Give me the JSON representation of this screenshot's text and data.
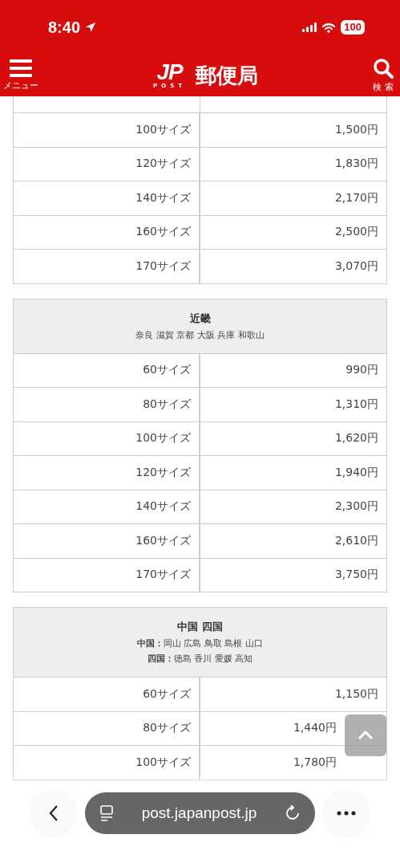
{
  "status_bar": {
    "time": "8:40",
    "battery": "100"
  },
  "header": {
    "menu_label": "メニュー",
    "logo_mark": "JP",
    "logo_sub": "POST",
    "title": "郵便局",
    "search_label": "検 索"
  },
  "sections": [
    {
      "rows": [
        {
          "size": "100サイズ",
          "price": "1,500円"
        },
        {
          "size": "120サイズ",
          "price": "1,830円"
        },
        {
          "size": "140サイズ",
          "price": "2,170円"
        },
        {
          "size": "160サイズ",
          "price": "2,500円"
        },
        {
          "size": "170サイズ",
          "price": "3,070円"
        }
      ]
    },
    {
      "name": "近畿",
      "areas": [
        "奈良 滋賀 京都 大阪 兵庫 和歌山"
      ],
      "rows": [
        {
          "size": "60サイズ",
          "price": "990円"
        },
        {
          "size": "80サイズ",
          "price": "1,310円"
        },
        {
          "size": "100サイズ",
          "price": "1,620円"
        },
        {
          "size": "120サイズ",
          "price": "1,940円"
        },
        {
          "size": "140サイズ",
          "price": "2,300円"
        },
        {
          "size": "160サイズ",
          "price": "2,610円"
        },
        {
          "size": "170サイズ",
          "price": "3,750円"
        }
      ]
    },
    {
      "name": "中国 四国",
      "areas": [
        "**中国：**岡山 広島 鳥取 島根 山口",
        "**四国：**徳島 香川 愛媛 高知"
      ],
      "rows": [
        {
          "size": "60サイズ",
          "price": "1,150円"
        },
        {
          "size": "80サイズ",
          "price": "1,440円"
        },
        {
          "size": "100サイズ",
          "price": "1,780円"
        }
      ]
    }
  ],
  "browser_bar": {
    "url": "post.japanpost.jp"
  }
}
